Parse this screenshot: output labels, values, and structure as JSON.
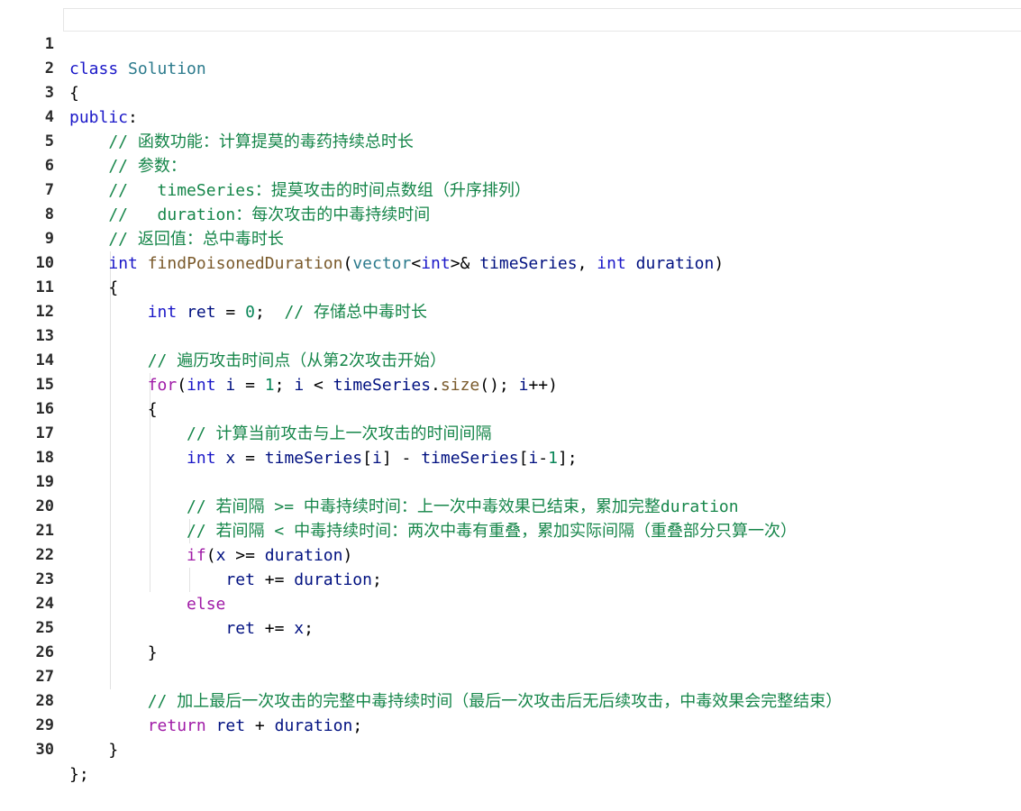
{
  "editor": {
    "language": "cpp",
    "colors": {
      "keyword": "#1a17c8",
      "control": "#a01ba7",
      "comment": "#16864a",
      "number": "#098658",
      "function": "#7a5a2b",
      "class": "#2b7a8c",
      "line_number": "#2b2b2b"
    },
    "lines": [
      {
        "n": "1",
        "text": "class Solution"
      },
      {
        "n": "2",
        "text": "{"
      },
      {
        "n": "3",
        "text": "public:"
      },
      {
        "n": "4",
        "text": "    // 函数功能：计算提莫的毒药持续总时长"
      },
      {
        "n": "5",
        "text": "    // 参数："
      },
      {
        "n": "6",
        "text": "    //   timeSeries：提莫攻击的时间点数组（升序排列）"
      },
      {
        "n": "7",
        "text": "    //   duration：每次攻击的中毒持续时间"
      },
      {
        "n": "8",
        "text": "    // 返回值：总中毒时长"
      },
      {
        "n": "9",
        "text": "    int findPoisonedDuration(vector<int>& timeSeries, int duration)"
      },
      {
        "n": "10",
        "text": "    {"
      },
      {
        "n": "11",
        "text": "        int ret = 0;  // 存储总中毒时长"
      },
      {
        "n": "12",
        "text": ""
      },
      {
        "n": "13",
        "text": "        // 遍历攻击时间点（从第2次攻击开始）"
      },
      {
        "n": "14",
        "text": "        for(int i = 1; i < timeSeries.size(); i++)"
      },
      {
        "n": "15",
        "text": "        {"
      },
      {
        "n": "16",
        "text": "            // 计算当前攻击与上一次攻击的时间间隔"
      },
      {
        "n": "17",
        "text": "            int x = timeSeries[i] - timeSeries[i-1];"
      },
      {
        "n": "18",
        "text": ""
      },
      {
        "n": "19",
        "text": "            // 若间隔 >= 中毒持续时间：上一次中毒效果已结束，累加完整duration"
      },
      {
        "n": "20",
        "text": "            // 若间隔 < 中毒持续时间：两次中毒有重叠，累加实际间隔（重叠部分只算一次）"
      },
      {
        "n": "21",
        "text": "            if(x >= duration)"
      },
      {
        "n": "22",
        "text": "                ret += duration;"
      },
      {
        "n": "23",
        "text": "            else"
      },
      {
        "n": "24",
        "text": "                ret += x;"
      },
      {
        "n": "25",
        "text": "        }"
      },
      {
        "n": "26",
        "text": ""
      },
      {
        "n": "27",
        "text": "        // 加上最后一次攻击的完整中毒持续时间（最后一次攻击后无后续攻击，中毒效果会完整结束）"
      },
      {
        "n": "28",
        "text": "        return ret + duration;"
      },
      {
        "n": "29",
        "text": "    }"
      },
      {
        "n": "30",
        "text": "};"
      }
    ]
  }
}
